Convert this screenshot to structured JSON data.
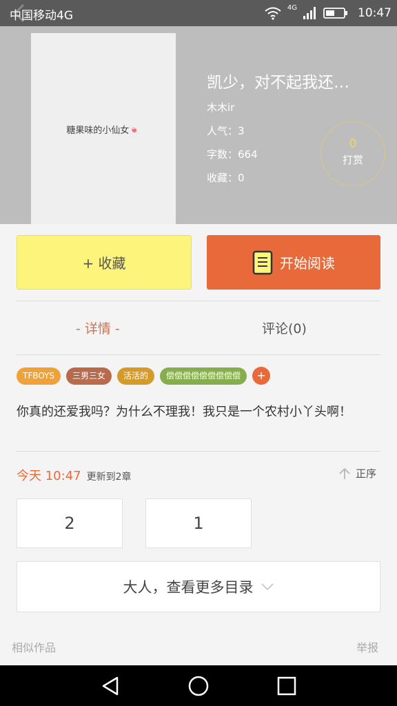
{
  "status_bar": {
    "carrier": "中国移动4G",
    "network": "4G",
    "time": "10:47"
  },
  "book": {
    "cover_text": "糖果味的小仙女🍬",
    "title": "凯少，对不起我还…",
    "author": "木木ir",
    "popularity": "人气：3",
    "word_count": "字数：664",
    "favorites": "收藏：0",
    "tip_count": "0",
    "tip_label": "打赏"
  },
  "actions": {
    "collect_label": "+ 收藏",
    "read_label": "开始阅读"
  },
  "tabs": {
    "detail": "- 详情 -",
    "comments": "评论(0)"
  },
  "tags": [
    {
      "label": "TFBOYS",
      "color": "#f0a23a"
    },
    {
      "label": "三男三女",
      "color": "#b86a4c"
    },
    {
      "label": "活活的",
      "color": "#d49a2c"
    },
    {
      "label": "偿偿偿偿偿偿偿偿偿",
      "color": "#86ad4e"
    }
  ],
  "tag_add": "+",
  "synopsis": "你真的还爱我吗？为什么不理我！我只是一个农村小丫头啊！",
  "update": {
    "time": "今天 10:47",
    "text": "更新到2章",
    "sort_label": "正序"
  },
  "chapters": [
    "2",
    "1"
  ],
  "more_label": "大人，查看更多目录",
  "footer": {
    "similar": "相似作品",
    "report": "举报"
  },
  "colors": {
    "accent": "#e8693a",
    "collect_bg": "#fdf47c",
    "header_bg": "#bdbdbd"
  }
}
